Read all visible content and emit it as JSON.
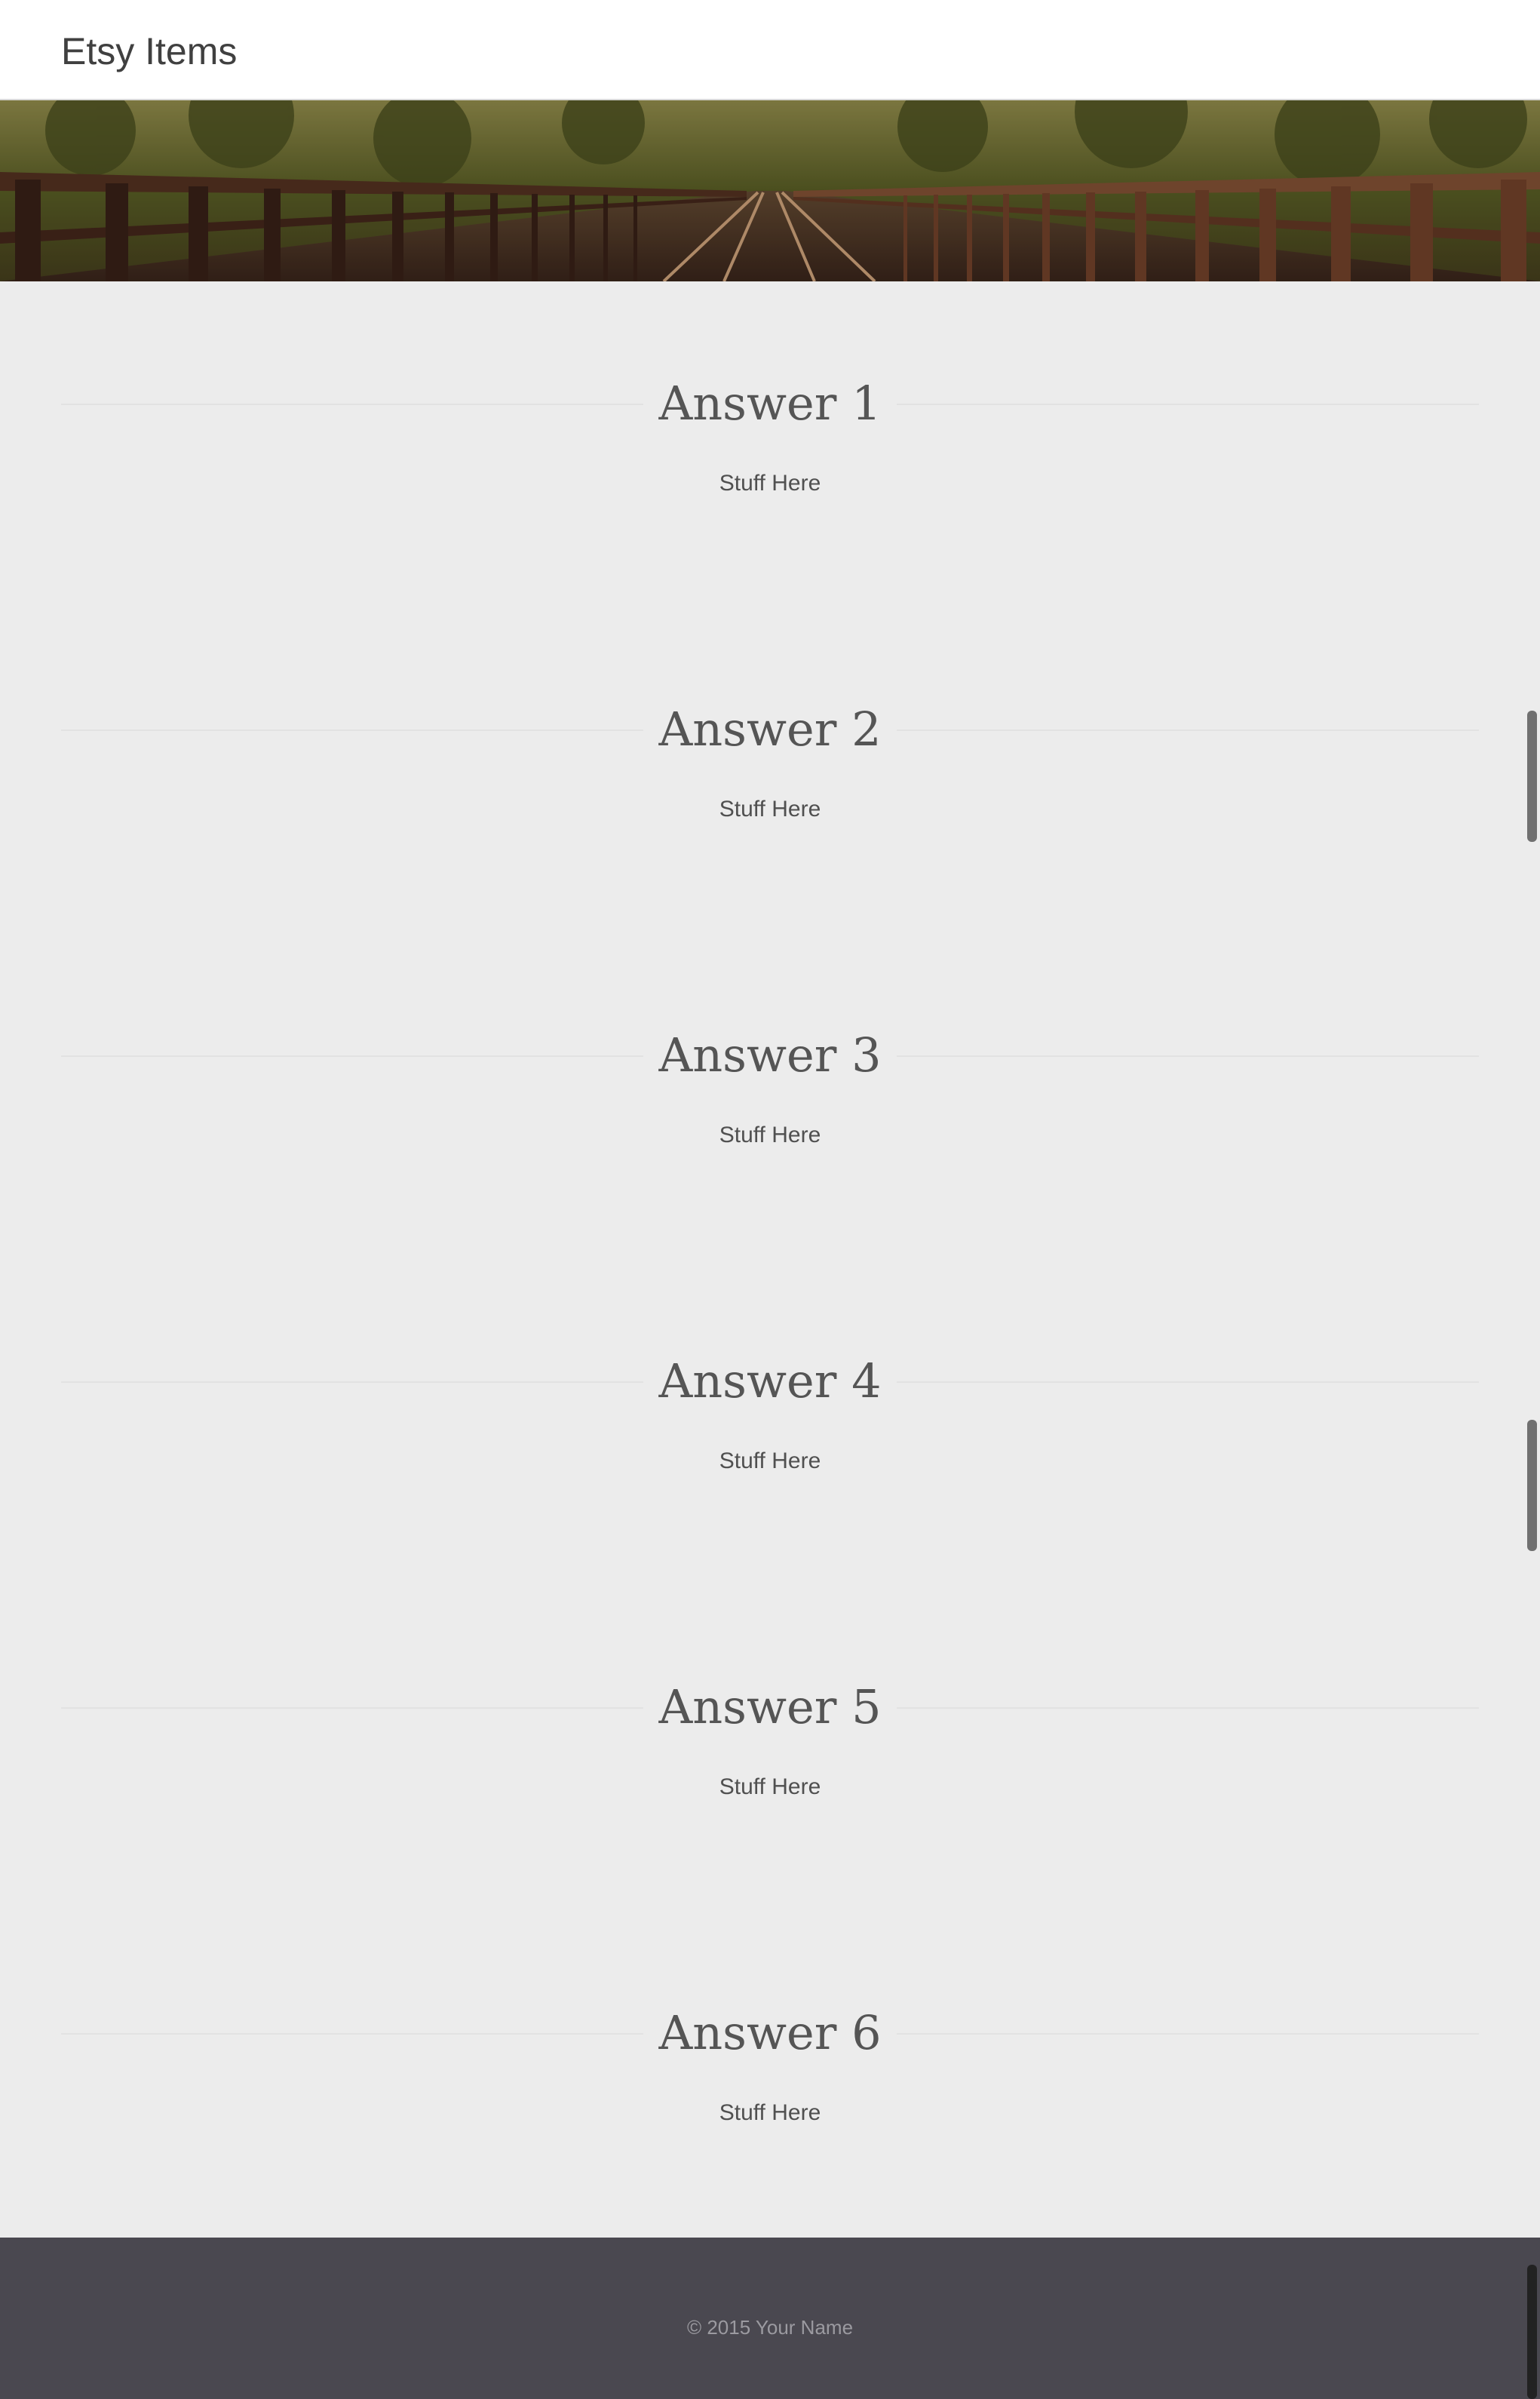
{
  "navbar": {
    "brand": "Etsy Items"
  },
  "hero": {
    "image": "railway-bridge-photo"
  },
  "answers": [
    {
      "title": "Answer 1",
      "body": "Stuff Here"
    },
    {
      "title": "Answer 2",
      "body": "Stuff Here"
    },
    {
      "title": "Answer 3",
      "body": "Stuff Here"
    },
    {
      "title": "Answer 4",
      "body": "Stuff Here"
    },
    {
      "title": "Answer 5",
      "body": "Stuff Here"
    },
    {
      "title": "Answer 6",
      "body": "Stuff Here"
    }
  ],
  "footer": {
    "copyright": "© 2015 Your Name"
  },
  "colors": {
    "page_background": "#ececec",
    "text": "#555555",
    "footer_background": "#4a4850",
    "footer_text": "#9b9aa0"
  }
}
